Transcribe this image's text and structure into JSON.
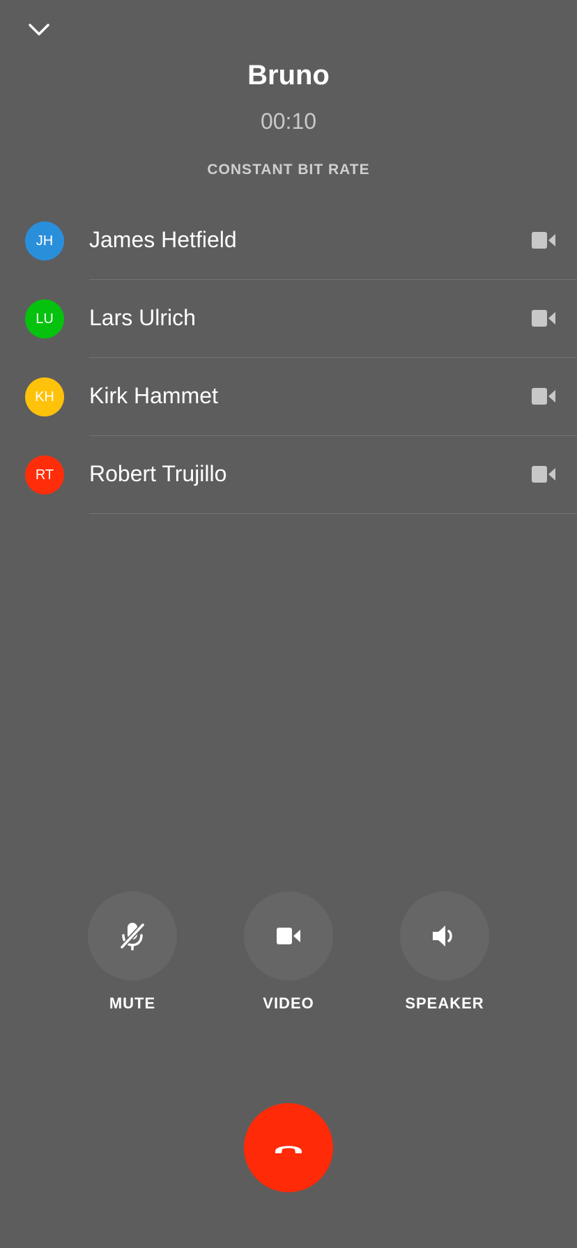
{
  "call": {
    "name": "Bruno",
    "timer": "00:10",
    "quality": "CONSTANT BIT RATE"
  },
  "icons": {
    "collapse": "chevron-down-icon",
    "participant_video": "video-camera-icon",
    "mute": "microphone-off-icon",
    "video": "video-camera-icon",
    "speaker": "speaker-icon",
    "hangup": "phone-hangup-icon"
  },
  "participants": [
    {
      "initials": "JH",
      "name": "James Hetfield",
      "color": "#2a8fdb"
    },
    {
      "initials": "LU",
      "name": "Lars Ulrich",
      "color": "#05c20e"
    },
    {
      "initials": "KH",
      "name": "Kirk Hammet",
      "color": "#ffc20a"
    },
    {
      "initials": "RT",
      "name": "Robert Trujillo",
      "color": "#ff2d0a"
    }
  ],
  "controls": {
    "mute_label": "MUTE",
    "video_label": "VIDEO",
    "speaker_label": "SPEAKER"
  },
  "colors": {
    "background": "#5d5d5d",
    "control_bg": "#666666",
    "hangup": "#ff2a07"
  }
}
